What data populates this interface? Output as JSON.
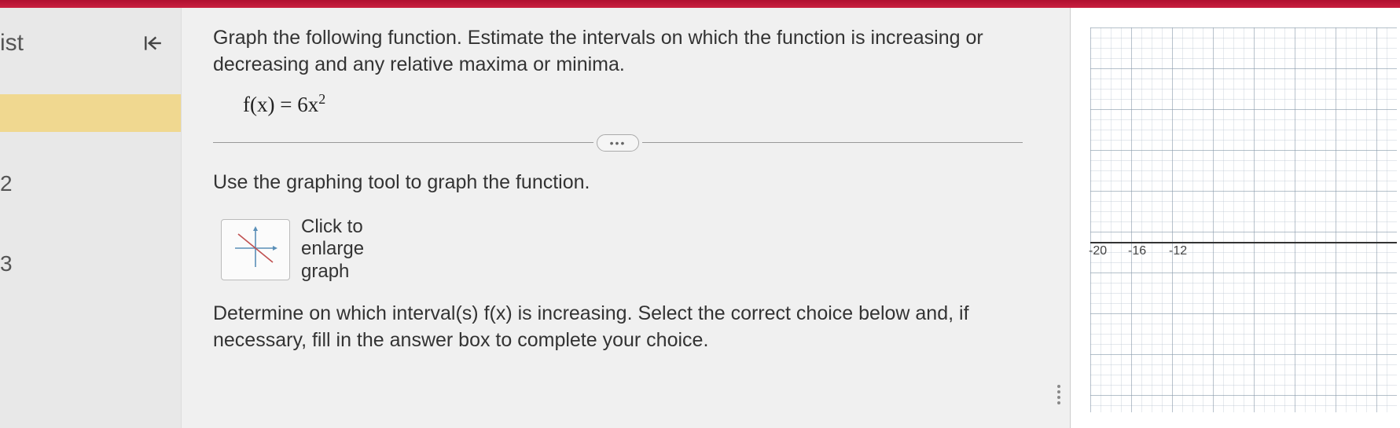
{
  "sidebar": {
    "title": "ist",
    "items": [
      "2",
      "3"
    ]
  },
  "question": {
    "prompt": "Graph the following function. Estimate the intervals on which the function is increasing or decreasing and any relative maxima or minima.",
    "formula_prefix": "f(x) = 6x",
    "formula_exp": "2",
    "instruction": "Use the graphing tool to graph the function.",
    "graph_button": "Click to\nenlarge\ngraph",
    "determine": "Determine on which interval(s) f(x) is increasing. Select the correct choice below and, if necessary, fill in the answer box to complete your choice."
  },
  "graph": {
    "x_ticks": [
      "-20",
      "-16",
      "-12"
    ]
  }
}
